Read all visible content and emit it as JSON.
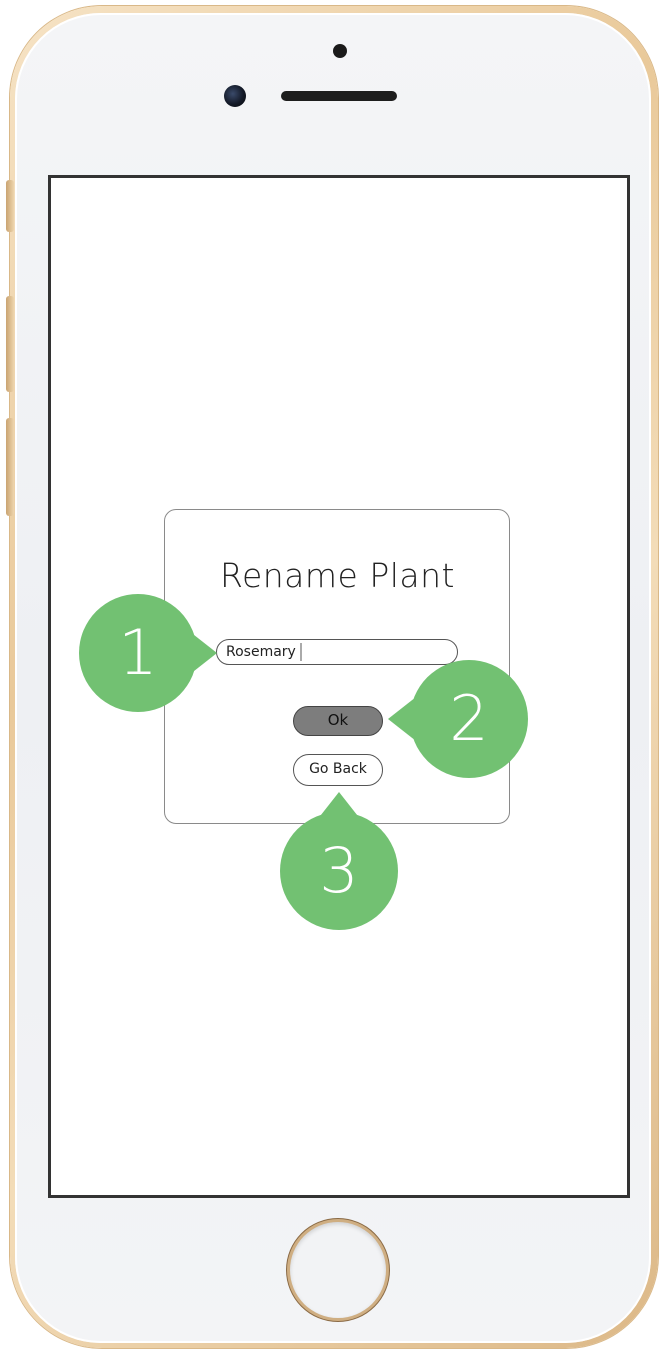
{
  "dialog": {
    "title": "Rename Plant",
    "input_value": "Rosemary",
    "ok_label": "Ok",
    "go_back_label": "Go Back"
  },
  "callouts": {
    "one": "1",
    "two": "2",
    "three": "3"
  },
  "colors": {
    "callout": "#72c172",
    "ok_button_fill": "#7d7d7d",
    "phone_frame": "#e9c99a"
  }
}
